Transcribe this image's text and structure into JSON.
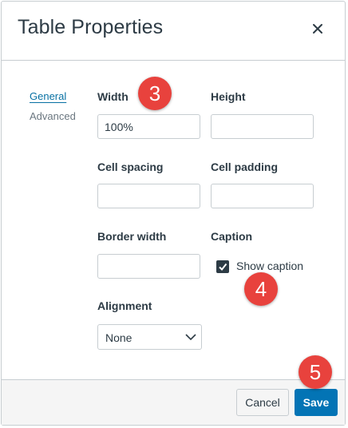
{
  "dialog": {
    "title": "Table Properties",
    "close_icon": "close-icon"
  },
  "tabs": [
    {
      "label": "General"
    },
    {
      "label": "Advanced"
    }
  ],
  "fields": {
    "width": {
      "label": "Width",
      "value": "100%"
    },
    "height": {
      "label": "Height",
      "value": ""
    },
    "cell_spacing": {
      "label": "Cell spacing",
      "value": ""
    },
    "cell_padding": {
      "label": "Cell padding",
      "value": ""
    },
    "border_width": {
      "label": "Border width",
      "value": ""
    },
    "caption": {
      "label": "Caption",
      "checkbox_label": "Show caption",
      "checked": true
    },
    "alignment": {
      "label": "Alignment",
      "value": "None"
    }
  },
  "footer": {
    "cancel_label": "Cancel",
    "save_label": "Save"
  },
  "annotations": [
    "3",
    "4",
    "5"
  ],
  "colors": {
    "accent": "#0374b5",
    "link": "#0770a3",
    "badge": "#e8423d",
    "text": "#2d3b45"
  }
}
